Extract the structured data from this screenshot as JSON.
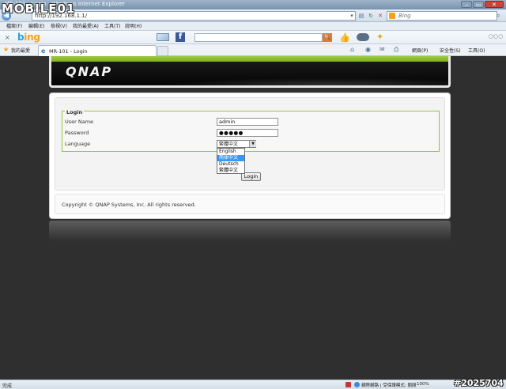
{
  "window": {
    "title": "MR-101 - Login - Windows Internet Explorer",
    "minimize_label": "‒",
    "maximize_label": "▭",
    "close_label": "✕"
  },
  "addressbar": {
    "url": "http://192.168.1.1/",
    "search_placeholder": "Bing",
    "back_label": "◀"
  },
  "menubar": {
    "items": [
      "檔案(F)",
      "編輯(E)",
      "檢視(V)",
      "我的最愛(A)",
      "工具(T)",
      "說明(H)"
    ]
  },
  "bingbar": {
    "close_label": "×",
    "logo_prefix": "b",
    "logo_rest": "ing",
    "search_button_label": "🔍",
    "more_label": "○○○"
  },
  "favoritesbar": {
    "favorites_label": "我的最愛",
    "tab_title": "MR-101 - Login",
    "commands": [
      "網頁(P)",
      "安全性(S)",
      "工具(O)"
    ]
  },
  "page": {
    "logo_text": "QNAP",
    "login": {
      "legend": "Login",
      "username_label": "User Name",
      "username_value": "admin",
      "password_label": "Password",
      "password_value": "●●●●●",
      "language_label": "Language",
      "language_selected": "繁體中文",
      "language_options": [
        "English",
        "简体中文",
        "Deutsch",
        "繁體中文"
      ],
      "language_highlighted": 1,
      "login_button": "Login"
    },
    "copyright": "Copyright © QNAP Systems, Inc. All rights reserved."
  },
  "statusbar": {
    "status": "完成",
    "zone": "網際網路 | 受保護模式: 關閉",
    "zoom": "100%"
  },
  "watermarks": {
    "site_logo": "MOBILE01",
    "post_id": "#2025704"
  }
}
